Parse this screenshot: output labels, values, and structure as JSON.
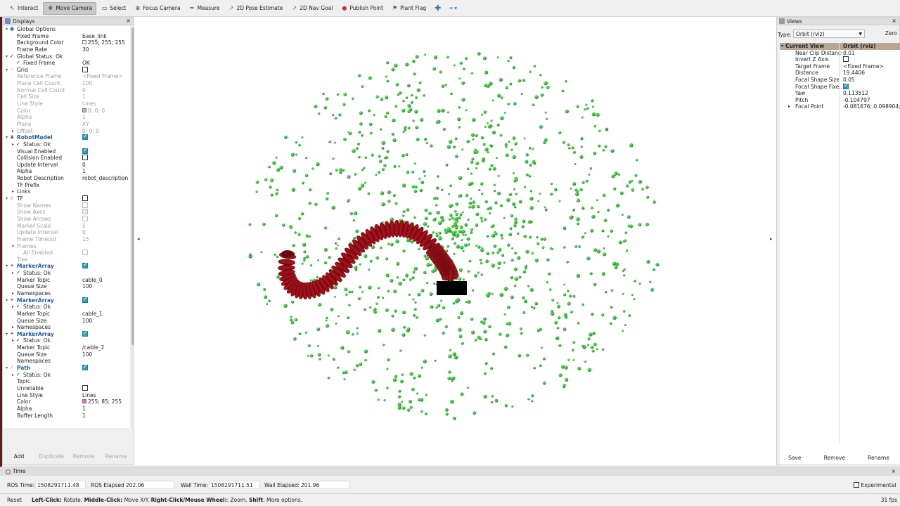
{
  "toolbar": {
    "tools": [
      {
        "label": "Interact",
        "icon": "interact-icon",
        "active": false
      },
      {
        "label": "Move Camera",
        "icon": "move-camera-icon",
        "active": true
      },
      {
        "label": "Select",
        "icon": "select-icon",
        "active": false
      },
      {
        "label": "Focus Camera",
        "icon": "focus-camera-icon",
        "active": false
      },
      {
        "label": "Measure",
        "icon": "measure-icon",
        "active": false
      },
      {
        "label": "2D Pose Estimate",
        "icon": "pose-estimate-icon",
        "active": false
      },
      {
        "label": "2D Nav Goal",
        "icon": "nav-goal-icon",
        "active": false
      },
      {
        "label": "Publish Point",
        "icon": "publish-point-icon",
        "active": false
      },
      {
        "label": "Plant Flag",
        "icon": "plant-flag-icon",
        "active": false
      }
    ]
  },
  "displays": {
    "title": "Displays",
    "close": "×",
    "rows": [
      {
        "indent": 0,
        "tw": "▾",
        "icon": "globe",
        "key": "Global Options",
        "val": "",
        "kind": "plain"
      },
      {
        "indent": 1,
        "key": "Fixed Frame",
        "val": "base_link"
      },
      {
        "indent": 1,
        "key": "Background Color",
        "val": "255; 255; 255",
        "swatch": "#ffffff"
      },
      {
        "indent": 1,
        "key": "Frame Rate",
        "val": "30"
      },
      {
        "indent": 0,
        "tw": "▾",
        "check": "✓",
        "key": "Global Status: Ok",
        "val": "",
        "kind": "plain"
      },
      {
        "indent": 1,
        "check": "✓",
        "key": "Fixed Frame",
        "val": "OK"
      },
      {
        "indent": 0,
        "tw": "▾",
        "icon": "grid",
        "key": "Grid",
        "val": "",
        "box": "off",
        "kind": "plain"
      },
      {
        "indent": 1,
        "key": "Reference Frame",
        "val": "<Fixed Frame>",
        "dim": true
      },
      {
        "indent": 1,
        "key": "Plane Cell Count",
        "val": "100",
        "dim": true
      },
      {
        "indent": 1,
        "key": "Normal Cell Count",
        "val": "0",
        "dim": true
      },
      {
        "indent": 1,
        "key": "Cell Size",
        "val": "1",
        "dim": true
      },
      {
        "indent": 1,
        "key": "Line Style",
        "val": "Lines",
        "dim": true
      },
      {
        "indent": 1,
        "key": "Color",
        "val": "0; 0; 0",
        "dim": true,
        "swatch": "#bbbbbb"
      },
      {
        "indent": 1,
        "key": "Alpha",
        "val": "1",
        "dim": true
      },
      {
        "indent": 1,
        "key": "Plane",
        "val": "XY",
        "dim": true
      },
      {
        "indent": 1,
        "tw": "▸",
        "key": "Offset",
        "val": "0; 0; 0",
        "dim": true
      },
      {
        "indent": 0,
        "tw": "▾",
        "icon": "robot",
        "key": "RobotModel",
        "val": "",
        "box": "on",
        "kind": "hdr"
      },
      {
        "indent": 1,
        "tw": "▸",
        "check": "✓",
        "key": "Status: Ok",
        "val": ""
      },
      {
        "indent": 1,
        "key": "Visual Enabled",
        "val": "",
        "box": "on"
      },
      {
        "indent": 1,
        "key": "Collision Enabled",
        "val": "",
        "box": "off"
      },
      {
        "indent": 1,
        "key": "Update Interval",
        "val": "0"
      },
      {
        "indent": 1,
        "key": "Alpha",
        "val": "1"
      },
      {
        "indent": 1,
        "key": "Robot Description",
        "val": "robot_description"
      },
      {
        "indent": 1,
        "key": "TF Prefix",
        "val": ""
      },
      {
        "indent": 1,
        "tw": "▸",
        "key": "Links",
        "val": ""
      },
      {
        "indent": 0,
        "tw": "▾",
        "icon": "tf",
        "key": "TF",
        "val": "",
        "box": "off",
        "kind": "plain"
      },
      {
        "indent": 1,
        "key": "Show Names",
        "val": "",
        "dim": true,
        "box": "dim"
      },
      {
        "indent": 1,
        "key": "Show Axes",
        "val": "",
        "dim": true,
        "box": "dimon"
      },
      {
        "indent": 1,
        "key": "Show Arrows",
        "val": "",
        "dim": true,
        "box": "dim"
      },
      {
        "indent": 1,
        "key": "Marker Scale",
        "val": "5",
        "dim": true
      },
      {
        "indent": 1,
        "key": "Update Interval",
        "val": "0",
        "dim": true
      },
      {
        "indent": 1,
        "key": "Frame Timeout",
        "val": "15",
        "dim": true
      },
      {
        "indent": 1,
        "tw": "▾",
        "key": "Frames",
        "val": "",
        "dim": true
      },
      {
        "indent": 2,
        "key": "All Enabled",
        "val": "",
        "dim": true,
        "box": "dim"
      },
      {
        "indent": 1,
        "key": "Tree",
        "val": "",
        "dim": true
      },
      {
        "indent": 0,
        "tw": "▾",
        "icon": "marker",
        "key": "MarkerArray",
        "val": "",
        "box": "on",
        "kind": "hdr"
      },
      {
        "indent": 1,
        "tw": "▸",
        "check": "✓",
        "key": "Status: Ok",
        "val": ""
      },
      {
        "indent": 1,
        "key": "Marker Topic",
        "val": "cable_0"
      },
      {
        "indent": 1,
        "key": "Queue Size",
        "val": "100"
      },
      {
        "indent": 1,
        "tw": "▸",
        "key": "Namespaces",
        "val": ""
      },
      {
        "indent": 0,
        "tw": "▾",
        "icon": "marker",
        "key": "MarkerArray",
        "val": "",
        "box": "on",
        "kind": "hdr"
      },
      {
        "indent": 1,
        "tw": "▸",
        "check": "✓",
        "key": "Status: Ok",
        "val": ""
      },
      {
        "indent": 1,
        "key": "Marker Topic",
        "val": "cable_1"
      },
      {
        "indent": 1,
        "key": "Queue Size",
        "val": "100"
      },
      {
        "indent": 1,
        "tw": "▸",
        "key": "Namespaces",
        "val": ""
      },
      {
        "indent": 0,
        "tw": "▾",
        "icon": "marker",
        "key": "MarkerArray",
        "val": "",
        "box": "on",
        "kind": "hdr"
      },
      {
        "indent": 1,
        "tw": "▸",
        "check": "✓",
        "key": "Status: Ok",
        "val": ""
      },
      {
        "indent": 1,
        "key": "Marker Topic",
        "val": "/cable_2"
      },
      {
        "indent": 1,
        "key": "Queue Size",
        "val": "100"
      },
      {
        "indent": 1,
        "key": "Namespaces",
        "val": ""
      },
      {
        "indent": 0,
        "tw": "▾",
        "icon": "path",
        "key": "Path",
        "val": "",
        "box": "on",
        "kind": "hdr"
      },
      {
        "indent": 1,
        "tw": "▸",
        "check": "✓",
        "key": "Status: Ok",
        "val": ""
      },
      {
        "indent": 1,
        "key": "Topic",
        "val": ""
      },
      {
        "indent": 1,
        "key": "Unreliable",
        "val": "",
        "box": "off"
      },
      {
        "indent": 1,
        "key": "Line Style",
        "val": "Lines"
      },
      {
        "indent": 1,
        "key": "Color",
        "val": "255; 85; 255",
        "swatch": "#ff55ff"
      },
      {
        "indent": 1,
        "key": "Alpha",
        "val": "1"
      },
      {
        "indent": 1,
        "key": "Buffer Length",
        "val": "1"
      }
    ],
    "buttons": {
      "add": "Add",
      "duplicate": "Duplicate",
      "remove": "Remove",
      "rename": "Rename"
    }
  },
  "views": {
    "title": "Views",
    "close": "×",
    "type_label": "Type:",
    "type_value": "Orbit (rviz)",
    "zero": "Zero",
    "head_key": "Current View",
    "head_val": "Orbit (rviz)",
    "rows": [
      {
        "key": "Near Clip Distance",
        "val": "0.01"
      },
      {
        "key": "Invert Z Axis",
        "val": "",
        "box": "off"
      },
      {
        "key": "Target Frame",
        "val": "<Fixed Frame>"
      },
      {
        "key": "Distance",
        "val": "19.4406"
      },
      {
        "key": "Focal Shape Size",
        "val": "0.05"
      },
      {
        "key": "Focal Shape Fixe...",
        "val": "",
        "box": "on"
      },
      {
        "key": "Yaw",
        "val": "0.113512"
      },
      {
        "key": "Pitch",
        "val": "-0.104797"
      },
      {
        "key": "Focal Point",
        "val": "-0.081676; 0.098904; 1...",
        "tw": "▸"
      }
    ],
    "buttons": {
      "save": "Save",
      "remove": "Remove",
      "rename": "Rename"
    }
  },
  "time": {
    "title": "Time",
    "close": "×",
    "ros_time_label": "ROS Time:",
    "ros_time": "1508291711.48",
    "ros_elapsed_label": "ROS Elapsed:",
    "ros_elapsed": "202.06",
    "wall_time_label": "Wall Time:",
    "wall_time": "1508291711.51",
    "wall_elapsed_label": "Wall Elapsed:",
    "wall_elapsed": "201.96",
    "experimental": "Experimental"
  },
  "status": {
    "reset": "Reset",
    "hint_lc": "Left-Click:",
    "hint_lc_t": " Rotate. ",
    "hint_mc": "Middle-Click:",
    "hint_mc_t": " Move X/Y. ",
    "hint_rc": "Right-Click/Mouse Wheel:",
    "hint_rc_t": ": Zoom. ",
    "hint_sh": "Shift",
    "hint_sh_t": ": More options.",
    "fps": "31 fps"
  },
  "colors": {
    "cable": "#b0121c",
    "cable_dark": "#6a0a10",
    "points": "#2db82d",
    "points_dark": "#1a7f1a",
    "base": "#000000"
  }
}
